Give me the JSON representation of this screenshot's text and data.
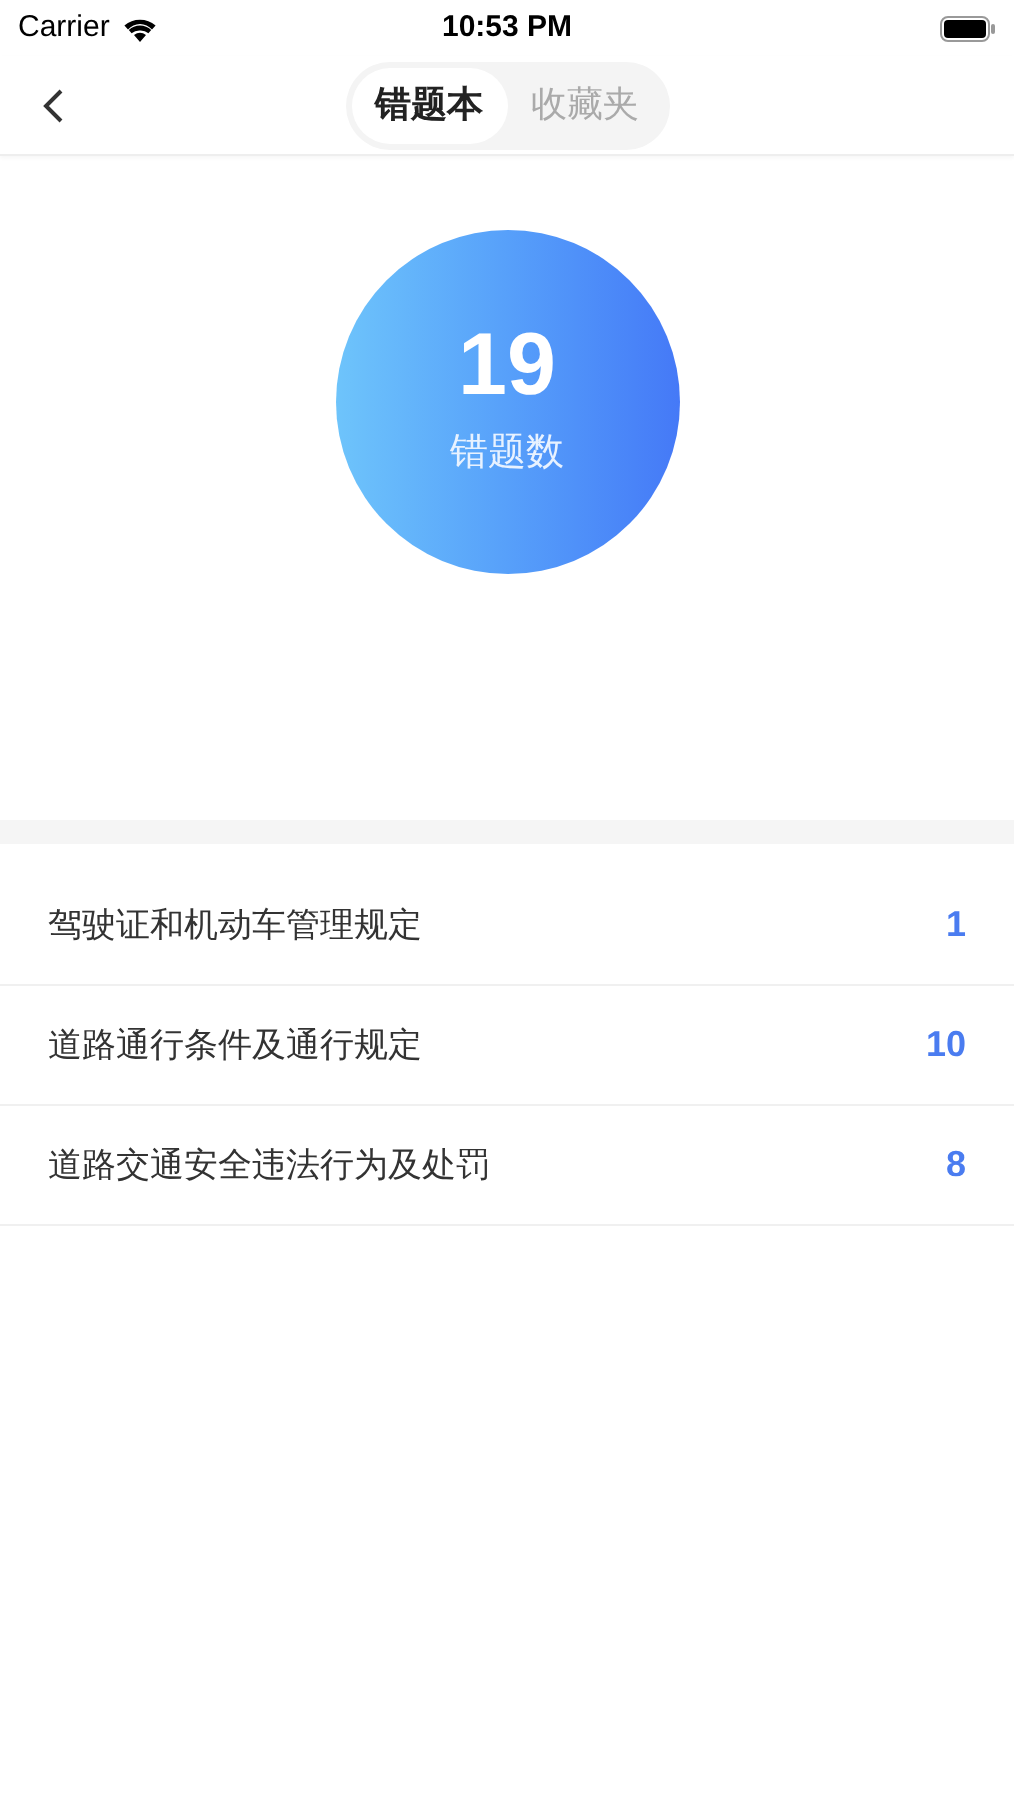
{
  "status_bar": {
    "carrier": "Carrier",
    "time": "10:53 PM"
  },
  "tabs": [
    {
      "label": "错题本",
      "selected": true
    },
    {
      "label": "收藏夹",
      "selected": false
    }
  ],
  "summary": {
    "count": "19",
    "label": "错题数"
  },
  "categories": [
    {
      "name": "驾驶证和机动车管理规定",
      "count": "1"
    },
    {
      "name": "道路通行条件及通行规定",
      "count": "10"
    },
    {
      "name": "道路交通安全违法行为及处罚",
      "count": "8"
    }
  ]
}
